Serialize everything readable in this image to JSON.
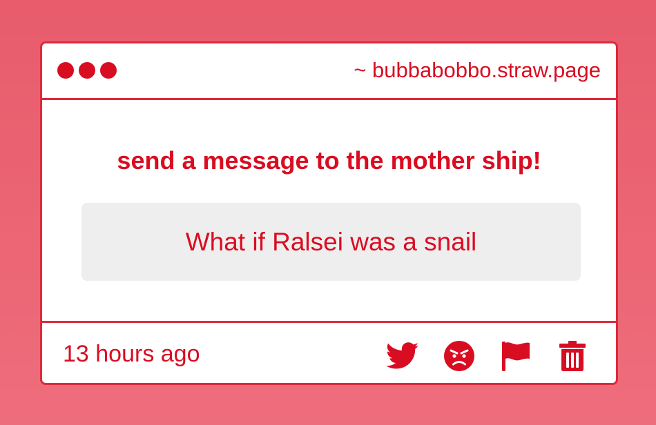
{
  "window": {
    "url": "~ bubbabobbo.straw.page"
  },
  "main": {
    "heading": "send a message to the mother ship!",
    "message": "What if Ralsei was a snail"
  },
  "footer": {
    "timestamp": "13 hours ago",
    "actions": [
      {
        "icon": "twitter-icon"
      },
      {
        "icon": "angry-face-icon"
      },
      {
        "icon": "flag-icon"
      },
      {
        "icon": "trash-icon"
      }
    ]
  },
  "colors": {
    "background": "#e85c6c",
    "accent": "#d90d22",
    "border": "#dd2a3a",
    "message_bg": "#efeeee"
  }
}
